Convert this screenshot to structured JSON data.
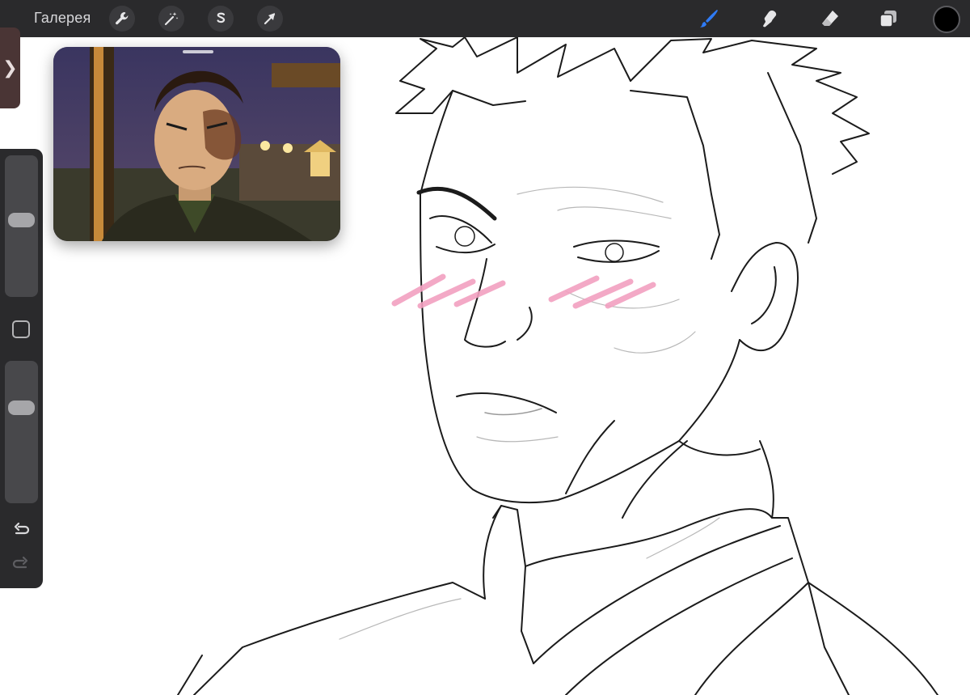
{
  "toolbar": {
    "gallery_label": "Галерея",
    "left_tools": [
      "wrench-icon",
      "magic-wand-icon",
      "selection-s-icon",
      "transform-arrow-icon"
    ],
    "right_tools": [
      "brush-icon",
      "smudge-icon",
      "eraser-icon",
      "layers-icon"
    ],
    "active_tool": "brush-icon",
    "current_color": "#000000",
    "accent_color": "#2f7bf5"
  },
  "sidebar": {
    "expand_arrow": "❯",
    "brush_size_level": 0.55,
    "opacity_level": 0.7
  },
  "reference": {
    "visible": true,
    "description_color": "#2d2a45"
  },
  "canvas": {
    "background": "#ffffff",
    "stroke_color": "#1a1a1a",
    "blush_color": "#f2a0c0"
  }
}
